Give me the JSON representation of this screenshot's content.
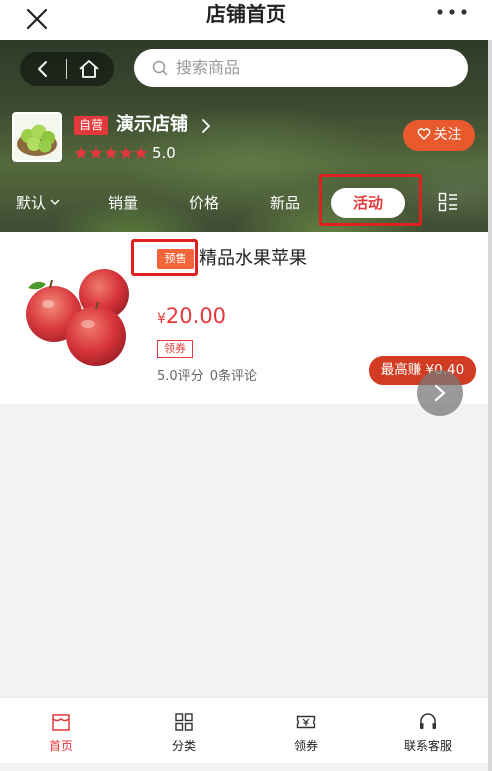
{
  "titlebar": {
    "title": "店铺首页",
    "close_icon": "close-icon",
    "more_icon": "more-dots-icon"
  },
  "header": {
    "search_placeholder": "搜索商品",
    "self_operated": "自营",
    "shop_name": "演示店铺",
    "rating": "5.0",
    "stars": 5,
    "follow_label": "关注"
  },
  "tabs": {
    "default": "默认",
    "sales": "销量",
    "price": "价格",
    "new": "新品",
    "activity": "活动"
  },
  "product": {
    "badge": "预售",
    "title": "精品水果苹果",
    "currency": "¥",
    "price": "20.00",
    "coupon": "领券",
    "score": "5.0评分",
    "comments": "0条评论",
    "earn_label": "最高赚 ¥0.40"
  },
  "bottom_nav": {
    "home": "首页",
    "category": "分类",
    "coupon": "领券",
    "service": "联系客服"
  },
  "colors": {
    "accent": "#e4393c",
    "follow": "#e85a2e",
    "highlight_box": "#e02020"
  }
}
